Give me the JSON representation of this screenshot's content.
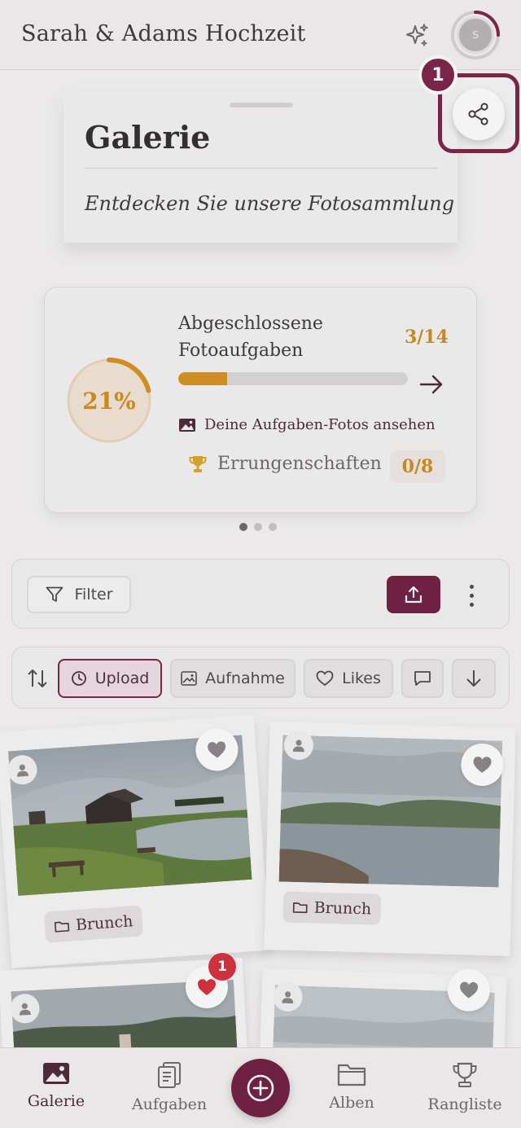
{
  "header": {
    "title": "Sarah & Adams Hochzeit",
    "avatar_initial": "S",
    "sparkle_icon": "sparkle-icon"
  },
  "gallery_card": {
    "title": "Galerie",
    "subtitle": "Entdecken Sie unsere Fotosammlung"
  },
  "share": {
    "step_number": "1",
    "icon": "share-icon"
  },
  "progress": {
    "percent_label": "21%",
    "percent_value": 0.21,
    "title": "Abgeschlossene Fotoaufgaben",
    "count": "3/14",
    "bar_fraction": 0.214,
    "photos_link": "Deine Aufgaben-Fotos ansehen",
    "achievements_label": "Errungenschaften",
    "achievements_count": "0/8",
    "active_dot": 0,
    "dot_count": 3
  },
  "filter_bar": {
    "filter_label": "Filter"
  },
  "sort_bar": {
    "chips": [
      "Upload",
      "Aufnahme",
      "Likes"
    ]
  },
  "photos": [
    {
      "album": "Brunch",
      "liked": false
    },
    {
      "album": "Brunch",
      "liked": false
    },
    {
      "album": "",
      "liked": true,
      "like_count": "1"
    },
    {
      "album": "",
      "liked": false
    }
  ],
  "bottom_nav": {
    "items": [
      "Galerie",
      "Aufgaben",
      "Alben",
      "Rangliste"
    ],
    "active": "Galerie"
  },
  "colors": {
    "brand": "#6f1b3f",
    "accent_gold": "#cf8a1c",
    "heart_red": "#d62b3a"
  }
}
